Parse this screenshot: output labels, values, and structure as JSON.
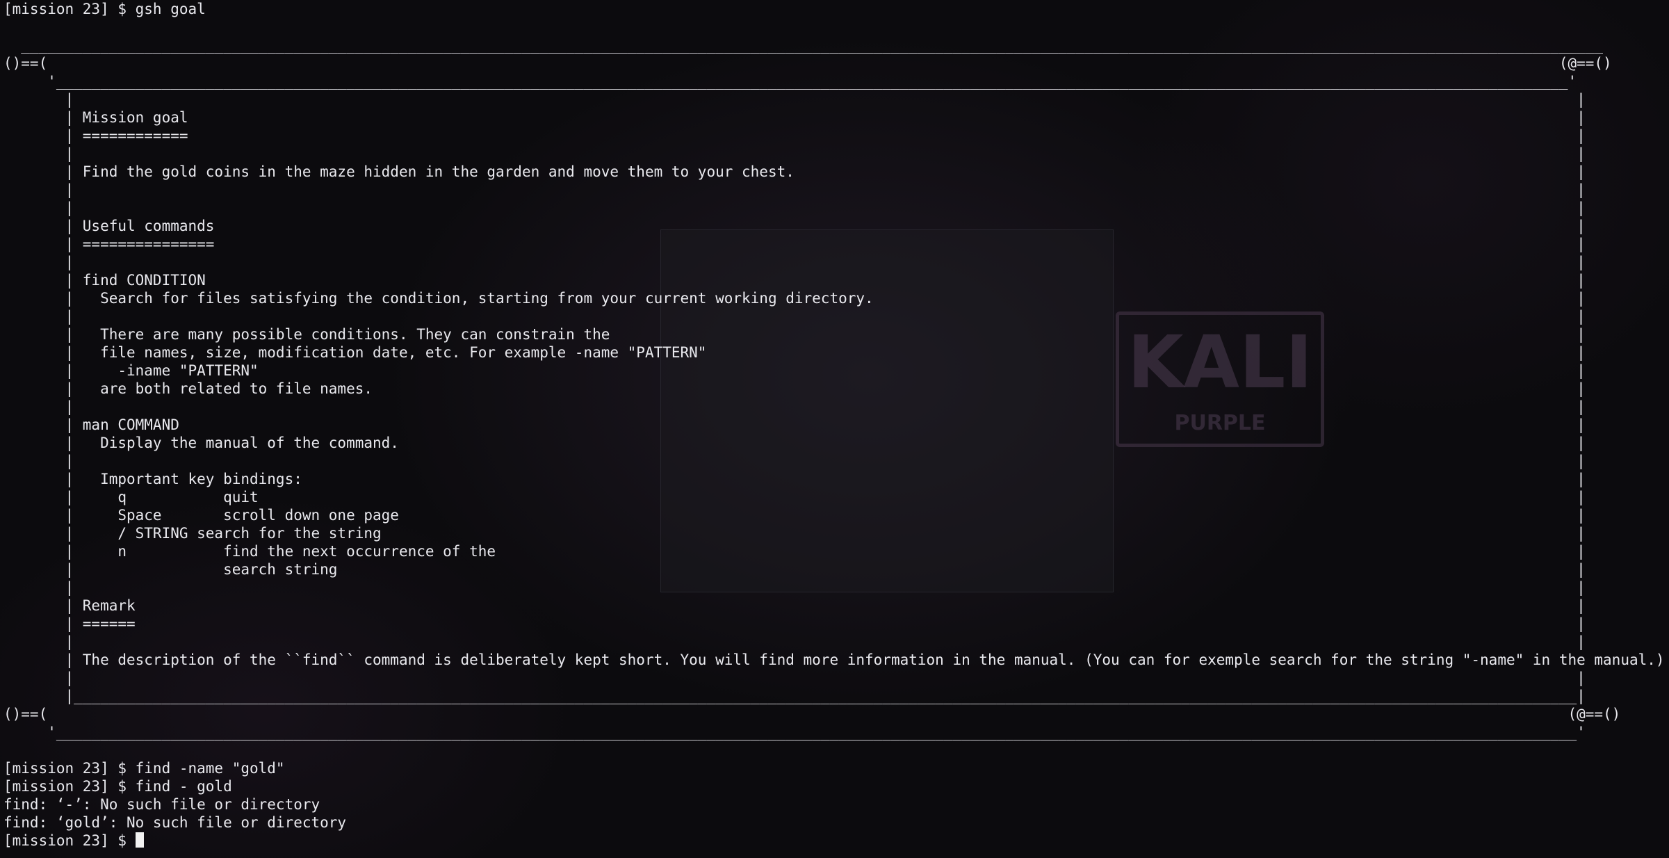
{
  "background": {
    "logo_text": "KALI",
    "logo_sub": "PURPLE"
  },
  "terminal": {
    "lines": [
      "[mission 23] $ gsh goal",
      "",
      "  ____________________________________________________________________________________________________________________________________________________________________________________",
      "()==(                                                                                                                                                                            (@==()",
      "     '____________________________________________________________________________________________________________________________________________________________________________'",
      "       |                                                                                                                                                                           |",
      "       | Mission goal                                                                                                                                                              |",
      "       | ============                                                                                                                                                              |",
      "       |                                                                                                                                                                           |",
      "       | Find the gold coins in the maze hidden in the garden and move them to your chest.                                                                                         |",
      "       |                                                                                                                                                                           |",
      "       |                                                                                                                                                                           |",
      "       | Useful commands                                                                                                                                                           |",
      "       | ===============                                                                                                                                                           |",
      "       |                                                                                                                                                                           |",
      "       | find CONDITION                                                                                                                                                            |",
      "       |   Search for files satisfying the condition, starting from your current working directory.                                                                                |",
      "       |                                                                                                                                                                           |",
      "       |   There are many possible conditions. They can constrain the                                                                                                              |",
      "       |   file names, size, modification date, etc. For example -name \"PATTERN\"                                                                                                   |",
      "       |     -iname \"PATTERN\"                                                                                                                                                      |",
      "       |   are both related to file names.                                                                                                                                         |",
      "       |                                                                                                                                                                           |",
      "       | man COMMAND                                                                                                                                                               |",
      "       |   Display the manual of the command.                                                                                                                                      |",
      "       |                                                                                                                                                                           |",
      "       |   Important key bindings:                                                                                                                                                 |",
      "       |     q           quit                                                                                                                                                      |",
      "       |     Space       scroll down one page                                                                                                                                      |",
      "       |     / STRING search for the string                                                                                                                                        |",
      "       |     n           find the next occurrence of the                                                                                                                           |",
      "       |                 search string                                                                                                                                             |",
      "       |                                                                                                                                                                           |",
      "       | Remark                                                                                                                                                                    |",
      "       | ======                                                                                                                                                                    |",
      "       |                                                                                                                                                                           |",
      "       | The description of the ``find`` command is deliberately kept short. You will find more information in the manual. (You can for exemple search for the string \"-name\" in the manual.) |",
      "       |                                                                                                                                                                           |",
      "       |___________________________________________________________________________________________________________________________________________________________________________|",
      "()==(                                                                                                                                                                             (@==()",
      "     '_____________________________________________________________________________________________________________________________________________________________________________'",
      "",
      "[mission 23] $ find -name \"gold\"",
      "[mission 23] $ find - gold",
      "find: ‘-’: No such file or directory",
      "find: ‘gold’: No such file or directory"
    ],
    "prompt": "[mission 23] $ "
  }
}
